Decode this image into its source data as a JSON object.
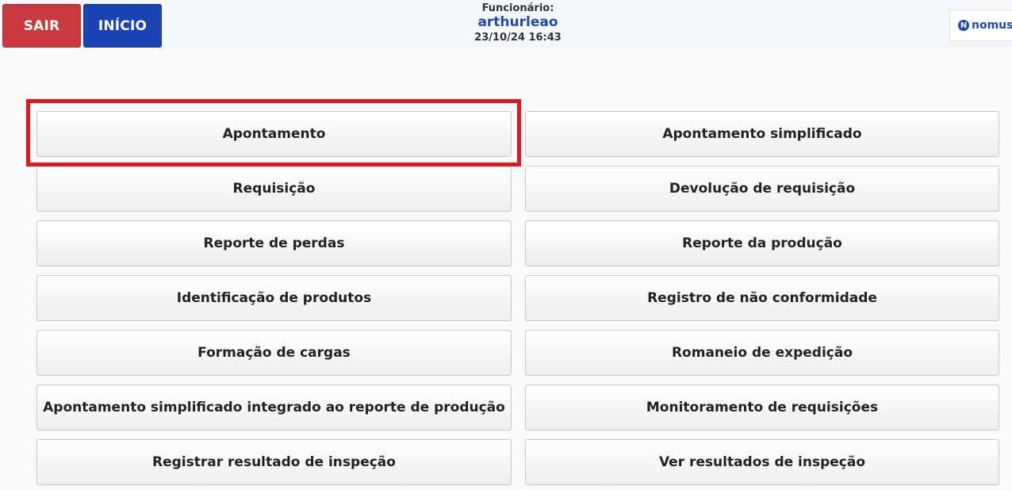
{
  "header": {
    "sair_label": "SAIR",
    "inicio_label": "INÍCIO",
    "employee_label": "Funcionário:",
    "employee_name": "arthurleao",
    "datetime": "23/10/24 16:43",
    "logo_text": "nomus"
  },
  "menu": {
    "left": [
      "Apontamento",
      "Requisição",
      "Reporte de perdas",
      "Identificação de produtos",
      "Formação de cargas",
      "Apontamento simplificado integrado ao reporte de produção",
      "Registrar resultado de inspeção"
    ],
    "right": [
      "Apontamento simplificado",
      "Devolução de requisição",
      "Reporte da produção",
      "Registro de não conformidade",
      "Romaneio de expedição",
      "Monitoramento de requisições",
      "Ver resultados de inspeção"
    ]
  },
  "colors": {
    "sair": "#c9383f",
    "inicio": "#1a43b4",
    "highlight": "#e3161c",
    "employee_name": "#1d4bb0"
  }
}
